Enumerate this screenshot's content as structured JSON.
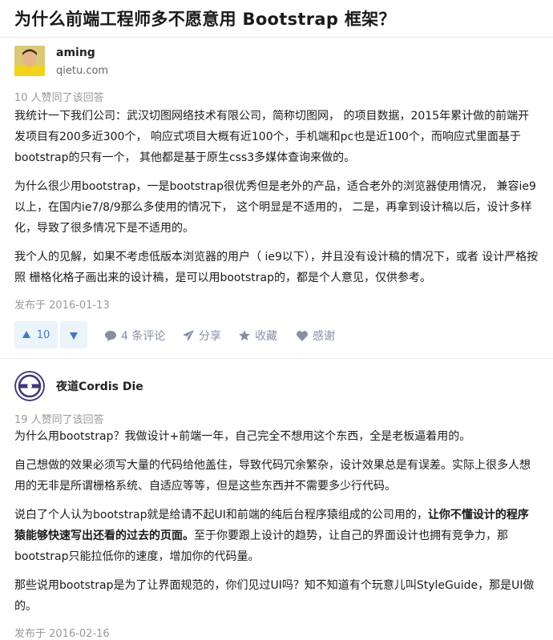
{
  "question": {
    "title": "为什么前端工程师多不愿意用 Bootstrap 框架？"
  },
  "answers": [
    {
      "author": {
        "name": "aming",
        "subtitle": "qietu.com"
      },
      "votes_text": "10 人赞同了该回答",
      "paragraphs": [
        "我统计一下我们公司：武汉切图网络技术有限公司，简称切图网， 的项目数据，2015年累计做的前端开发项目有200多近300个， 响应式项目大概有近100个，手机端和pc也是近100个，而响应式里面基于bootstrap的只有一个， 其他都是基于原生css3多媒体查询来做的。",
        "为什么很少用bootstrap，一是bootstrap很优秀但是老外的产品，适合老外的浏览器使用情况， 兼容ie9以上，在国内ie7/8/9那么多使用的情况下， 这个明显是不适用的， 二是，再拿到设计稿以后，设计多样化，导致了很多情况下是不适用的。",
        "我个人的见解，如果不考虑低版本浏览器的用户（ ie9以下），并且没有设计稿的情况下，或者 设计严格按照 栅格化格子画出来的设计稿，是可以用bootstrap的，都是个人意见，仅供参考。"
      ],
      "date": "发布于 2016-01-13",
      "actions": {
        "upvote_count": "10",
        "comments": "4 条评论",
        "share": "分享",
        "collect": "收藏",
        "thanks": "感谢"
      }
    },
    {
      "author": {
        "name": "夜道Cordis Die"
      },
      "votes_text": "19 人赞同了该回答",
      "lines": {
        "l1": "为什么用bootstrap？我做设计+前端一年，自己完全不想用这个东西，全是老板逼着用的。",
        "l2": "自己想做的效果必须写大量的代码给他盖住，导致代码冗余繁杂，设计效果总是有误差。实际上很多人想用的无非是所谓栅格系统、自适应等等，但是这些东西并不需要多少行代码。",
        "l3_pre": "说白了个人认为bootstrap就是给请不起UI和前端的纯后台程序猿组成的公司用的，",
        "l3_bold": "让你不懂设计的程序猿能够快速写出还看的过去的页面。",
        "l3_post": "至于你要跟上设计的趋势，让自己的界面设计也拥有竞争力，那bootstrap只能拉低你的速度，增加你的代码量。",
        "l4": "那些说用bootstrap是为了让界面规范的，你们见过UI吗？知不知道有个玩意儿叫StyleGuide，那是UI做的。"
      },
      "date": "发布于 2016-02-16"
    }
  ],
  "colors": {
    "accent": "#3e7ac2",
    "accent_bg": "#ebf3fb",
    "muted": "#8590a6"
  },
  "icons": [
    "triangle-up-icon",
    "triangle-down-icon",
    "comment-icon",
    "share-icon",
    "star-icon",
    "heart-icon"
  ]
}
